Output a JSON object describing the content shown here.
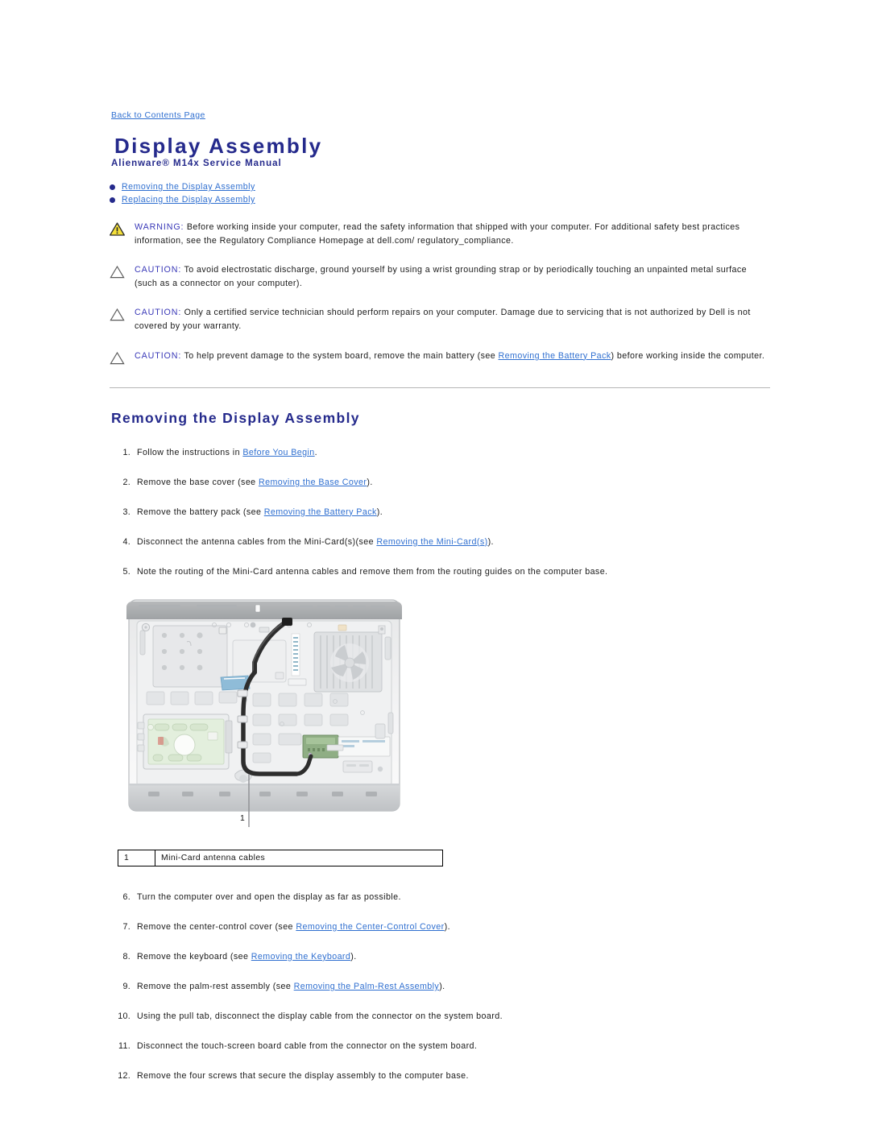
{
  "nav": {
    "back_link": "Back to Contents Page"
  },
  "header": {
    "title": "Display Assembly",
    "subtitle": "Alienware® M14x Service Manual"
  },
  "toc": {
    "items": [
      {
        "label": "Removing the Display Assembly"
      },
      {
        "label": "Replacing the Display Assembly"
      }
    ]
  },
  "admonitions": [
    {
      "icon": "warning-triangle-icon",
      "keyword": "WARNING:",
      "text": " Before working inside your computer, read the safety information that shipped with your computer. For additional safety best practices information, see the Regulatory Compliance Homepage at dell.com/ regulatory_compliance."
    },
    {
      "icon": "caution-triangle-icon",
      "keyword": "CAUTION:",
      "text": " To avoid electrostatic discharge, ground yourself by using a wrist grounding strap or by periodically touching an unpainted metal surface (such as a connector on your computer)."
    },
    {
      "icon": "caution-triangle-icon",
      "keyword": "CAUTION:",
      "text": " Only a certified service technician should perform repairs on your computer. Damage due to servicing that is not authorized by Dell is not covered by your warranty."
    },
    {
      "icon": "caution-triangle-icon",
      "keyword": "CAUTION:",
      "text_before": " To help prevent damage to the system board, remove the main battery (see ",
      "link": "Removing the Battery Pack",
      "text_after": ") before working inside the computer."
    }
  ],
  "section": {
    "title": "Removing the Display Assembly"
  },
  "steps": [
    {
      "num": "1.",
      "before": "Follow the instructions in ",
      "link": "Before You Begin",
      "after": "."
    },
    {
      "num": "2.",
      "before": "Remove the base cover (see ",
      "link": "Removing the Base Cover",
      "after": ")."
    },
    {
      "num": "3.",
      "before": "Remove the battery pack (see ",
      "link": "Removing the Battery Pack",
      "after": ")."
    },
    {
      "num": "4.",
      "before": "Disconnect the antenna cables from the Mini-Card(s)(see ",
      "link": "Removing the Mini-Card(s)",
      "after": ")."
    },
    {
      "num": "5.",
      "before": "Note the routing of the Mini-Card antenna cables and remove them from the routing guides on the computer base.",
      "link": "",
      "after": ""
    }
  ],
  "steps_after": [
    {
      "num": "6.",
      "before": "Turn the computer over and open the display as far as possible.",
      "link": "",
      "after": ""
    },
    {
      "num": "7.",
      "before": "Remove the center-control cover (see ",
      "link": "Removing the Center-Control Cover",
      "after": ")."
    },
    {
      "num": "8.",
      "before": "Remove the keyboard (see ",
      "link": "Removing the Keyboard",
      "after": ")."
    },
    {
      "num": "9.",
      "before": "Remove the palm-rest assembly (see ",
      "link": "Removing the Palm-Rest Assembly",
      "after": ")."
    },
    {
      "num": "10.",
      "before": "Using the pull tab, disconnect the display cable from the connector on the system board.",
      "link": "",
      "after": ""
    },
    {
      "num": "11.",
      "before": "Disconnect the touch-screen board cable from the connector on the system board.",
      "link": "",
      "after": ""
    },
    {
      "num": "12.",
      "before": "Remove the four screws that secure the display assembly to the computer base.",
      "link": "",
      "after": ""
    }
  ],
  "figure": {
    "callout_number": "1",
    "legend": [
      {
        "index": "1",
        "label": "Mini-Card antenna cables"
      }
    ]
  },
  "colors": {
    "heading": "#252a8c",
    "link": "#2f6fd0",
    "admon_keyword": "#3a39b8",
    "warning_fill": "#f5e03a",
    "body_text": "#1a1a1a"
  }
}
